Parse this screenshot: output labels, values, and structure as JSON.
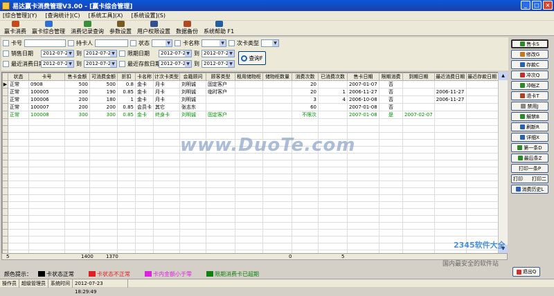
{
  "window": {
    "title": "易达赢卡消费管理V3.00 - [赢卡综合管理]"
  },
  "menu": [
    "[综合管理](Y)",
    "[查询统计](C)",
    "[系统工具](X)",
    "[系统设置](S)"
  ],
  "toolbar": [
    {
      "label": "赢卡消费",
      "icon": "card-icon",
      "color": "#c24a1e"
    },
    {
      "label": "赢卡综合管理",
      "icon": "manage-icon",
      "color": "#2f6fd0"
    },
    {
      "label": "消费记录查询",
      "icon": "record-icon",
      "color": "#3a8f3a"
    },
    {
      "label": "参数设置",
      "icon": "settings-icon",
      "color": "#7a5a20"
    },
    {
      "label": "用户权限设置",
      "icon": "users-icon",
      "color": "#305090"
    },
    {
      "label": "数据备份",
      "icon": "backup-icon",
      "color": "#b04a20"
    },
    {
      "label": "系统帮助 F1",
      "icon": "help-icon",
      "color": "#2060a0"
    }
  ],
  "filters": {
    "card_no": "卡号",
    "holder": "持卡人",
    "state": "状态",
    "card_name": "卡名称",
    "card_type": "次卡类型",
    "sale_date": "销售日期",
    "limit_date": "限期日期",
    "last_consume": "最近消费日期",
    "last_deposit": "最近存款日期",
    "to": "到",
    "date": "2012-07-23",
    "query": "查询F"
  },
  "table": {
    "headers": [
      "状态",
      "卡号",
      "售卡金额",
      "可消费金额",
      "折扣",
      "卡名称",
      "计次卡类型",
      "会籍顾问",
      "顾客类型",
      "租用储物柜",
      "储物柜数量",
      "消费次数",
      "已消费次数",
      "售卡日期",
      "限期消费",
      "到期日期",
      "最近消费日期",
      "最近存款日期"
    ],
    "rows": [
      [
        "正常",
        "0908",
        "500",
        "500",
        "0.8",
        "金卡",
        "月卡",
        "刘明诚",
        "固定客户",
        "",
        "",
        "20",
        "",
        "2007-01-07",
        "否",
        "",
        "",
        ""
      ],
      [
        "正常",
        "100005",
        "200",
        "190",
        "0.85",
        "金卡",
        "月卡",
        "刘明诚",
        "临时客户",
        "",
        "",
        "20",
        "1",
        "2006-11-27",
        "否",
        "",
        "2006-11-27",
        ""
      ],
      [
        "正常",
        "100006",
        "200",
        "180",
        "1",
        "金卡",
        "月卡",
        "刘明诚",
        "",
        "",
        "",
        "3",
        "4",
        "2006-10-08",
        "否",
        "",
        "2006-11-27",
        ""
      ],
      [
        "正常",
        "100007",
        "200",
        "200",
        "0.85",
        "会员卡",
        "其它",
        "张志东",
        "",
        "",
        "",
        "60",
        "",
        "2007-01-08",
        "否",
        "",
        "",
        ""
      ],
      [
        "正常",
        "100008",
        "300",
        "300",
        "0.85",
        "金卡",
        "终身卡",
        "刘明诚",
        "固定客户",
        "",
        "",
        "不限次",
        "",
        "2007-01-08",
        "是",
        "2007-02-07",
        "",
        ""
      ]
    ],
    "totals": {
      "count": "5",
      "sale": "1400",
      "consume": "1370",
      "locker": "0",
      "used": "5"
    }
  },
  "side_buttons": [
    "售卡S",
    "修改G",
    "存款C",
    "冲次Q",
    "冲帐Z",
    "退卡T",
    "禁用J",
    "解禁B",
    "刷新R",
    "详细X",
    "第一条D",
    "最后条Z"
  ],
  "side_buttons2": [
    "打印一条P",
    "打印",
    "打印二",
    "消费历史L"
  ],
  "legend": {
    "title": "颜色提示：",
    "items": [
      {
        "label": "卡状态正常",
        "color": "#000000"
      },
      {
        "label": "卡状态不正常",
        "color": "#e02020"
      },
      {
        "label": "卡内金额小于零",
        "color": "#e020e0"
      },
      {
        "label": "限期消费卡已超期",
        "color": "#108010"
      }
    ]
  },
  "status": {
    "operator_label": "操作员",
    "operator": "超级管理员",
    "time_label": "系统时间",
    "time": "2012-07-23 18:29:49"
  },
  "exit": "退出Q",
  "watermark": "www.DuoTe.com",
  "logo": {
    "brand": "2345软件大全",
    "tagline": "国内最安全的软件站"
  }
}
